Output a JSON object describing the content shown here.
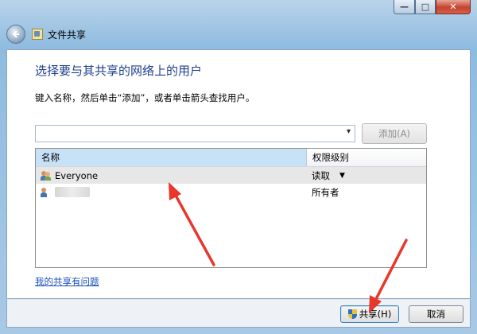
{
  "window": {
    "title": "文件共享",
    "controls": {
      "minimize": "—",
      "maximize": "□",
      "close": "✕"
    },
    "back_icon": "back-arrow-icon"
  },
  "main": {
    "heading": "选择要与其共享的网络上的用户",
    "instruction": "键入名称，然后单击“添加”，或者单击箭头查找用户。",
    "combo": {
      "value": "",
      "arrow": "▾"
    },
    "add_button": "添加(A)",
    "table": {
      "columns": [
        "名称",
        "权限级别"
      ],
      "rows": [
        {
          "name": "Everyone",
          "permission": "读取",
          "has_dropdown": true,
          "icon": "users-group-icon",
          "selected": true
        },
        {
          "name": "",
          "permission": "所有者",
          "has_dropdown": false,
          "icon": "user-icon",
          "redacted": true
        }
      ],
      "dropdown_glyph": "▼"
    },
    "trouble_link": "我的共享有问题"
  },
  "footer": {
    "share_button": "共享(H)",
    "cancel_button": "取消"
  },
  "colors": {
    "heading": "#1e3f8c",
    "link": "#1b52b8",
    "annotation_arrow": "#e8362b",
    "header_selected": "#c7e1f7"
  }
}
